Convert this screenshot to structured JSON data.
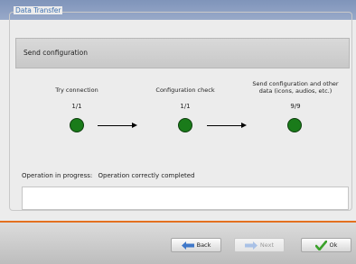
{
  "window": {
    "group_title": "Data Transfer",
    "header": "Send configuration"
  },
  "steps": [
    {
      "title": "Try connection",
      "count": "1/1",
      "status_color": "#1a7b1a"
    },
    {
      "title": "Configuration check",
      "count": "1/1",
      "status_color": "#1a7b1a"
    },
    {
      "title_line1": "Send configuration and other",
      "title_line2": "data (icons, audios, etc.)",
      "count": "9/9",
      "status_color": "#1a7b1a"
    }
  ],
  "status": {
    "label": "Operation in progress:",
    "value": "Operation correctly completed"
  },
  "buttons": {
    "back": "Back",
    "next": "Next",
    "ok": "Ok"
  },
  "icons": {
    "back": "arrow-left-icon",
    "next": "arrow-right-icon",
    "ok": "checkmark-icon"
  },
  "colors": {
    "accent": "#e3701f",
    "success": "#1a7b1a",
    "title_bar": "#8a9dc1"
  }
}
